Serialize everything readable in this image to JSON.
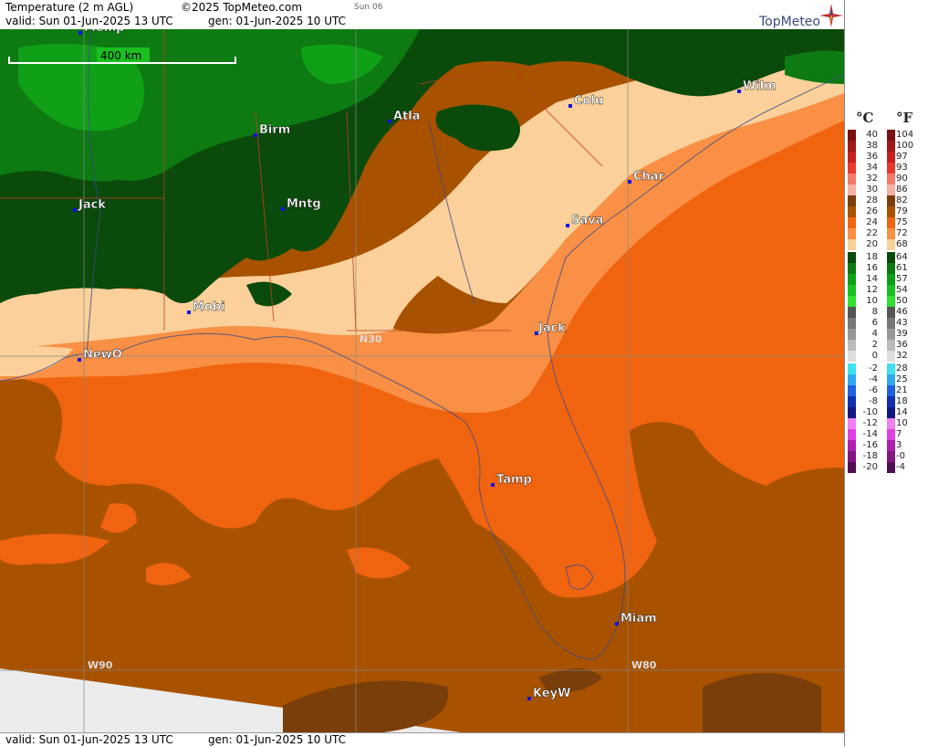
{
  "header": {
    "title": "Temperature (2 m AGL)",
    "copyright": "©2025 TopMeteo.com",
    "day_tab": "Sun 06",
    "valid": "valid:  Sun  01-Jun-2025  13 UTC",
    "gen": "gen: 01-Jun-2025 10 UTC",
    "logo": "TopMeteo"
  },
  "footer": {
    "valid": "valid:  Sun  01-Jun-2025  13 UTC",
    "gen": "gen: 01-Jun-2025 10 UTC"
  },
  "map": {
    "scale_label": "400 km",
    "grid_labels": [
      "N30",
      "W90",
      "W80"
    ],
    "cities": [
      "Memp",
      "Wilm",
      "Colu",
      "Atla",
      "Birm",
      "Char",
      "Jack",
      "Mntg",
      "Sava",
      "Mobi",
      "NewO",
      "Tamp",
      "Miam",
      "KeyW"
    ]
  },
  "legend": {
    "celsius_unit": "°C",
    "fahrenheit_unit": "°F",
    "rows": [
      {
        "c": "40",
        "f": "104",
        "color": "#7a1010"
      },
      {
        "c": "38",
        "f": "100",
        "color": "#a01818"
      },
      {
        "c": "36",
        "f": "97",
        "color": "#c82020"
      },
      {
        "c": "34",
        "f": "93",
        "color": "#e83a2a"
      },
      {
        "c": "32",
        "f": "90",
        "color": "#f47a6a"
      },
      {
        "c": "30",
        "f": "86",
        "color": "#f7b0a4"
      },
      {
        "c": "28",
        "f": "82",
        "color": "#7a3e0a"
      },
      {
        "c": "26",
        "f": "79",
        "color": "#a85200"
      },
      {
        "c": "24",
        "f": "75",
        "color": "#f06410"
      },
      {
        "c": "22",
        "f": "72",
        "color": "#f99045"
      },
      {
        "c": "20",
        "f": "68",
        "color": "#fbd09a"
      },
      {
        "c": "18",
        "f": "64",
        "color": "#0a4a0a"
      },
      {
        "c": "16",
        "f": "61",
        "color": "#0d7a12"
      },
      {
        "c": "14",
        "f": "57",
        "color": "#10a018"
      },
      {
        "c": "12",
        "f": "54",
        "color": "#18c020"
      },
      {
        "c": "10",
        "f": "50",
        "color": "#30e030"
      },
      {
        "c": "8",
        "f": "46",
        "color": "#555555"
      },
      {
        "c": "6",
        "f": "43",
        "color": "#777777"
      },
      {
        "c": "4",
        "f": "39",
        "color": "#999999"
      },
      {
        "c": "2",
        "f": "36",
        "color": "#bbbbbb"
      },
      {
        "c": "0",
        "f": "32",
        "color": "#dddddd"
      },
      {
        "c": "-2",
        "f": "28",
        "color": "#40e0f0"
      },
      {
        "c": "-4",
        "f": "25",
        "color": "#30a8f0"
      },
      {
        "c": "-6",
        "f": "21",
        "color": "#2060e0"
      },
      {
        "c": "-8",
        "f": "18",
        "color": "#1030b0"
      },
      {
        "c": "-10",
        "f": "14",
        "color": "#101880"
      },
      {
        "c": "-12",
        "f": "10",
        "color": "#f080f0"
      },
      {
        "c": "-14",
        "f": "7",
        "color": "#e040e0"
      },
      {
        "c": "-16",
        "f": "3",
        "color": "#b020b0"
      },
      {
        "c": "-18",
        "f": "-0",
        "color": "#801880"
      },
      {
        "c": "-20",
        "f": "-4",
        "color": "#501050"
      }
    ]
  }
}
